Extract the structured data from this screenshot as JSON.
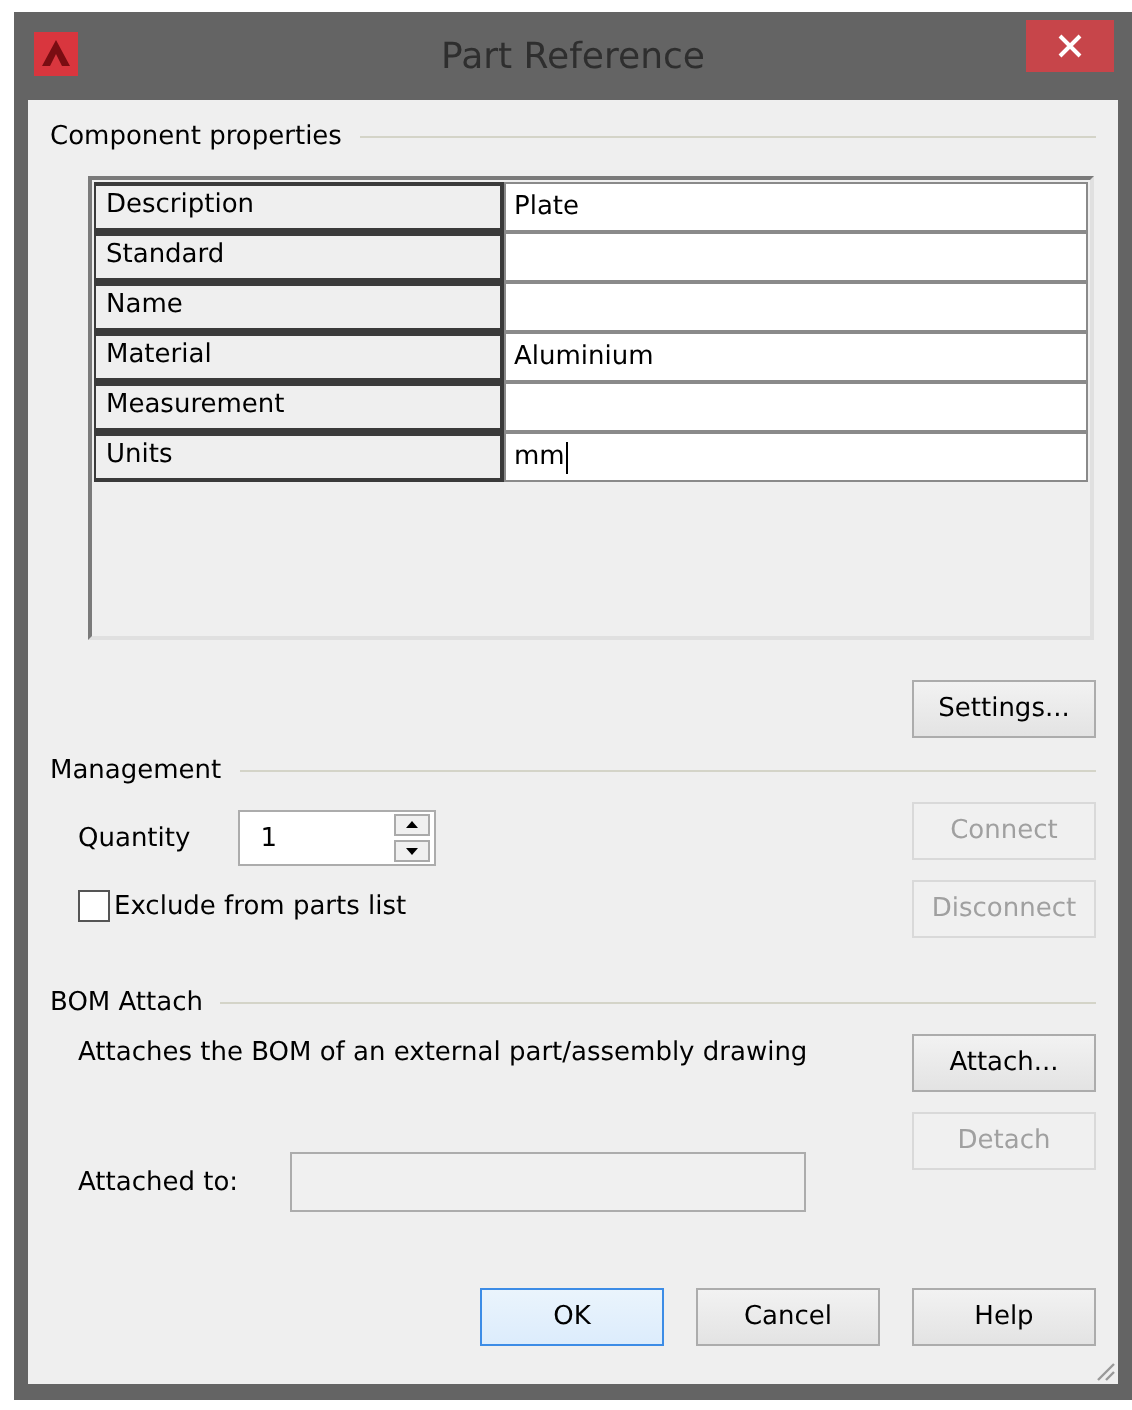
{
  "window": {
    "title": "Part Reference"
  },
  "component_properties": {
    "heading": "Component properties",
    "rows": [
      {
        "name": "Description",
        "value": "Plate",
        "editing": false
      },
      {
        "name": "Standard",
        "value": "",
        "editing": false
      },
      {
        "name": "Name",
        "value": "",
        "editing": false
      },
      {
        "name": "Material",
        "value": "Aluminium",
        "editing": false
      },
      {
        "name": "Measurement",
        "value": "",
        "editing": false
      },
      {
        "name": "Units",
        "value": "mm",
        "editing": true
      }
    ],
    "settings_button": {
      "label": "Settings...",
      "disabled": false
    }
  },
  "management": {
    "heading": "Management",
    "quantity_label": "Quantity",
    "quantity": "1",
    "exclude": {
      "label": "Exclude from parts list",
      "checked": false
    },
    "buttons": [
      {
        "label": "Connect",
        "disabled": true
      },
      {
        "label": "Disconnect",
        "disabled": true
      }
    ]
  },
  "bom_attach": {
    "heading": "BOM Attach",
    "description": "Attaches the BOM of an external part/assembly drawing",
    "buttons": [
      {
        "label": "Attach...",
        "disabled": false
      },
      {
        "label": "Detach",
        "disabled": true
      }
    ],
    "attached_to_label": "Attached to:"
  },
  "buttons": [
    {
      "label": "OK",
      "default": true
    },
    {
      "label": "Cancel",
      "default": false
    },
    {
      "label": "Help",
      "default": false
    }
  ]
}
